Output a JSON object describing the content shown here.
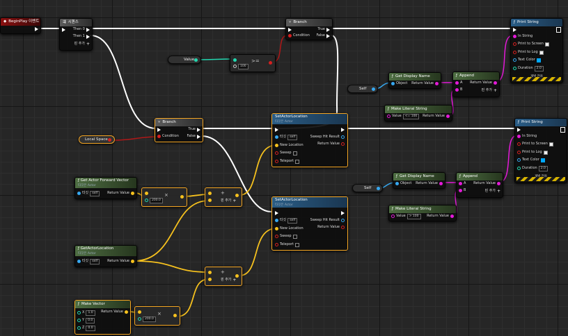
{
  "nodes": {
    "begin_play": {
      "title": "BeginPlay 이벤트"
    },
    "sequence": {
      "title": "시퀀스",
      "then0": "Then 0",
      "then1": "Then 1",
      "add_pin": "핀 추가"
    },
    "branch1": {
      "title": "Branch",
      "condition": "Condition",
      "true": "True",
      "false": "False"
    },
    "branch2": {
      "title": "Branch",
      "condition": "Condition",
      "true": "True",
      "false": "False"
    },
    "greater": {
      "op": ">=",
      "value": "100"
    },
    "value_var": {
      "label": "Value"
    },
    "local_space": {
      "label": "Local Space"
    },
    "print1": {
      "title": "Print String",
      "in_string": "In String",
      "print_screen": "Print to Screen",
      "print_log": "Print to Log",
      "text_color": "Text Color",
      "duration": "Duration",
      "duration_value": "2.0",
      "dev_only": "개발 전용"
    },
    "print2": {
      "title": "Print String",
      "in_string": "In String",
      "print_screen": "Print to Screen",
      "print_log": "Print to Log",
      "text_color": "Text Color",
      "duration": "Duration",
      "duration_value": "2.0",
      "dev_only": "개발 전용"
    },
    "display1": {
      "title": "Get Display Name",
      "object": "Object",
      "ret": "Return Value"
    },
    "display2": {
      "title": "Get Display Name",
      "object": "Object",
      "ret": "Return Value"
    },
    "append1": {
      "title": "Append",
      "a": "A",
      "b": "B",
      "ret": "Return Value",
      "add_pin": "핀 추가"
    },
    "append2": {
      "title": "Append",
      "a": "A",
      "b": "B",
      "ret": "Return Value",
      "add_pin": "핀 추가"
    },
    "self1": {
      "label": "Self"
    },
    "self2": {
      "label": "Self"
    },
    "literal1": {
      "title": "Make Literal String",
      "value": "Value",
      "value_text": "<= 100"
    },
    "literal2": {
      "title": "Make Literal String",
      "value": "Value",
      "value_text": "> 100"
    },
    "set_loc1": {
      "title": "SetActorLocation",
      "subtitle": "타깃은 Actor",
      "target": "타깃",
      "self": "self",
      "new_location": "New Location",
      "sweep": "Sweep",
      "teleport": "Teleport",
      "sweep_hit": "Sweep Hit Result",
      "ret": "Return Value"
    },
    "set_loc2": {
      "title": "SetActorLocation",
      "subtitle": "타깃은 Actor",
      "target": "타깃",
      "self": "self",
      "new_location": "New Location",
      "sweep": "Sweep",
      "teleport": "Teleport",
      "sweep_hit": "Sweep Hit Result",
      "ret": "Return Value"
    },
    "fwd_vec": {
      "title": "Get Actor Forward Vector",
      "subtitle": "타깃은 Actor",
      "target": "타깃",
      "self": "self",
      "ret": "Return Value"
    },
    "get_loc": {
      "title": "GetActorLocation",
      "subtitle": "타깃은 Actor",
      "target": "타깃",
      "self": "self",
      "ret": "Return Value"
    },
    "mult1": {
      "op": "×",
      "value": "200.0"
    },
    "mult2": {
      "op": "×",
      "value": "200.0"
    },
    "add1": {
      "op": "+",
      "add_pin": "핀 추가"
    },
    "add2": {
      "op": "+",
      "add_pin": "핀 추가"
    },
    "make_vec": {
      "title": "Make Vector",
      "x": "X",
      "y": "Y",
      "z": "Z",
      "x_val": "1.0",
      "y_val": "0.0",
      "z_val": "0.0",
      "ret": "Return Value"
    }
  },
  "colors": {
    "exec": "#ffffff",
    "bool": "#b01818",
    "string": "#e41ad8",
    "vector": "#f6c11e",
    "object": "#36a8f0",
    "float": "#22d8b0",
    "selection": "#f5a623"
  }
}
